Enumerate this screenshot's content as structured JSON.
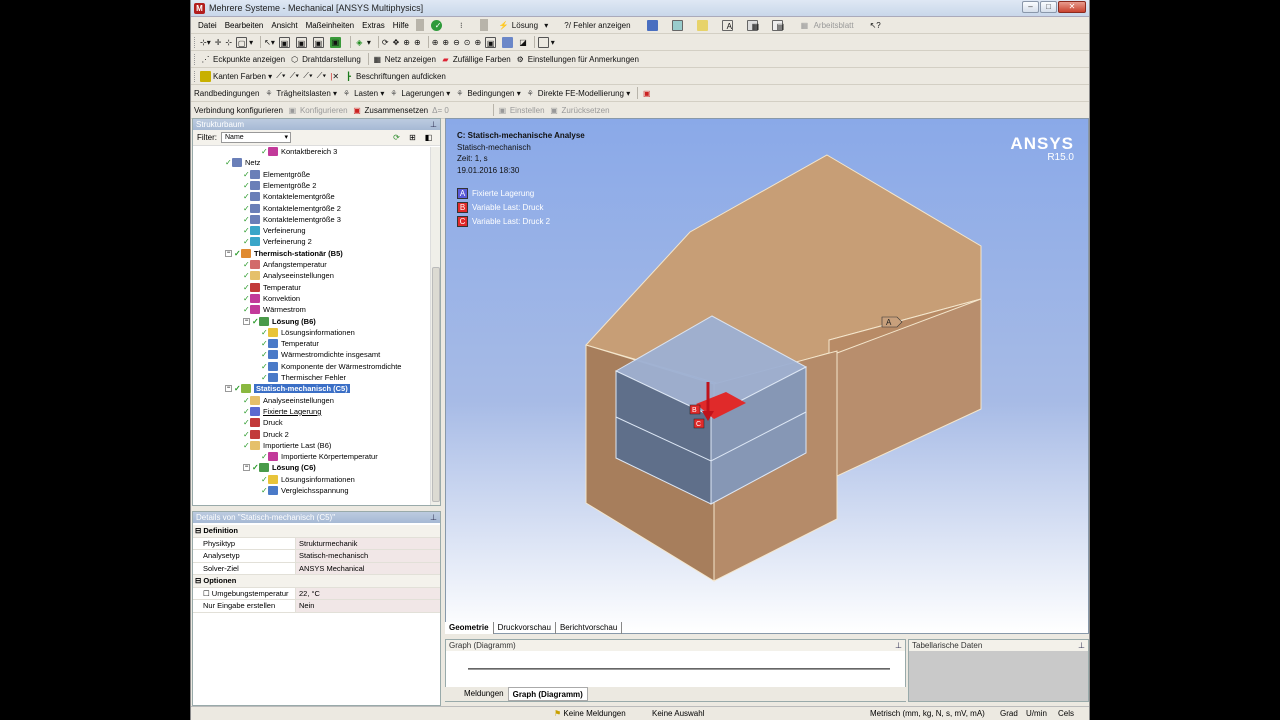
{
  "window": {
    "title": "Mehrere Systeme - Mechanical [ANSYS Multiphysics]"
  },
  "menu": [
    "Datei",
    "Bearbeiten",
    "Ansicht",
    "Maßeinheiten",
    "Extras",
    "Hilfe"
  ],
  "toolbar1": {
    "solve": "Lösung",
    "show_errors": "?/ Fehler anzeigen",
    "worksheet": "Arbeitsblatt"
  },
  "toolbar3": {
    "corners": "Eckpunkte anzeigen",
    "wireframe": "Drahtdarstellung",
    "mesh": "Netz anzeigen",
    "random_colors": "Zufällige Farben",
    "annotation_settings": "Einstellungen für Anmerkungen"
  },
  "toolbar4": {
    "edge_colors": "Kanten Farben",
    "labels": "Beschriftungen aufdicken"
  },
  "toolbar5": {
    "bc": "Randbedingungen",
    "inertial": "Trägheitslasten",
    "loads": "Lasten",
    "supports": "Lagerungen",
    "conditions": "Bedingungen",
    "direct_fe": "Direkte FE-Modellierung"
  },
  "toolbar6": {
    "connection": "Verbindung konfigurieren",
    "configure": "Konfigurieren",
    "assemble": "Zusammensetzen",
    "delta": "Δ=",
    "delta_value": "0",
    "set": "Einstellen",
    "reset": "Zurücksetzen"
  },
  "tree": {
    "title": "Strukturbaum",
    "filter_label": "Filter:",
    "filter_value": "Name",
    "nodes": [
      {
        "label": "Kontaktbereich 3",
        "level": 3,
        "icon": "#c23a9a"
      },
      {
        "label": "Netz",
        "level": 1,
        "icon": "#6a7fb8"
      },
      {
        "label": "Elementgröße",
        "level": 2,
        "icon": "#6a7fb8"
      },
      {
        "label": "Elementgröße 2",
        "level": 2,
        "icon": "#6a7fb8"
      },
      {
        "label": "Kontaktelementgröße",
        "level": 2,
        "icon": "#6a7fb8"
      },
      {
        "label": "Kontaktelementgröße 2",
        "level": 2,
        "icon": "#6a7fb8"
      },
      {
        "label": "Kontaktelementgröße 3",
        "level": 2,
        "icon": "#6a7fb8"
      },
      {
        "label": "Verfeinerung",
        "level": 2,
        "icon": "#3aa6c8"
      },
      {
        "label": "Verfeinerung 2",
        "level": 2,
        "icon": "#3aa6c8"
      },
      {
        "label": "Thermisch-stationär (B5)",
        "level": 1,
        "icon": "#e08a30",
        "bold": true
      },
      {
        "label": "Anfangstemperatur",
        "level": 2,
        "icon": "#d26b6b"
      },
      {
        "label": "Analyseeinstellungen",
        "level": 2,
        "icon": "#e5c06a"
      },
      {
        "label": "Temperatur",
        "level": 2,
        "icon": "#c23a3a"
      },
      {
        "label": "Konvektion",
        "level": 2,
        "icon": "#c23a9a"
      },
      {
        "label": "Wärmestrom",
        "level": 2,
        "icon": "#c23a9a"
      },
      {
        "label": "Lösung (B6)",
        "level": 2,
        "icon": "#4a9a4a",
        "bold": true
      },
      {
        "label": "Lösungsinformationen",
        "level": 3,
        "icon": "#e8c43a"
      },
      {
        "label": "Temperatur",
        "level": 3,
        "icon": "#4a7ac8"
      },
      {
        "label": "Wärmestromdichte insgesamt",
        "level": 3,
        "icon": "#4a7ac8"
      },
      {
        "label": "Komponente der Wärmestromdichte",
        "level": 3,
        "icon": "#4a7ac8"
      },
      {
        "label": "Thermischer Fehler",
        "level": 3,
        "icon": "#4a7ac8"
      },
      {
        "label": "Statisch-mechanisch (C5)",
        "level": 1,
        "icon": "#8ab840",
        "bold": true,
        "selected": true
      },
      {
        "label": "Analyseeinstellungen",
        "level": 2,
        "icon": "#e5c06a"
      },
      {
        "label": "Fixierte Lagerung",
        "level": 2,
        "icon": "#5a6ad0",
        "underline": true
      },
      {
        "label": "Druck",
        "level": 2,
        "icon": "#c23a3a"
      },
      {
        "label": "Druck 2",
        "level": 2,
        "icon": "#c23a3a"
      },
      {
        "label": "Importierte Last (B6)",
        "level": 2,
        "icon": "#e5c06a"
      },
      {
        "label": "Importierte Körpertemperatur",
        "level": 3,
        "icon": "#c23a9a"
      },
      {
        "label": "Lösung (C6)",
        "level": 2,
        "icon": "#4a9a4a",
        "bold": true
      },
      {
        "label": "Lösungsinformationen",
        "level": 3,
        "icon": "#e8c43a"
      },
      {
        "label": "Vergleichsspannung",
        "level": 3,
        "icon": "#4a7ac8"
      }
    ]
  },
  "details": {
    "title": "Details von \"Statisch-mechanisch (C5)\"",
    "rows": [
      {
        "k": "Definition",
        "group": true
      },
      {
        "k": "Physiktyp",
        "v": "Strukturmechanik"
      },
      {
        "k": "Analysetyp",
        "v": "Statisch-mechanisch"
      },
      {
        "k": "Solver-Ziel",
        "v": "ANSYS Mechanical"
      },
      {
        "k": "Optionen",
        "group": true
      },
      {
        "k": "Umgebungstemperatur",
        "v": "22, °C",
        "check": true
      },
      {
        "k": "Nur Eingabe erstellen",
        "v": "Nein"
      }
    ]
  },
  "viewport": {
    "heading": "C: Statisch-mechanische Analyse",
    "sub": "Statisch-mechanisch",
    "time": "Zeit: 1, s",
    "date": "19.01.2016 18:30",
    "legend": [
      {
        "letter": "A",
        "label": "Fixierte Lagerung",
        "color": "#5a5ad8"
      },
      {
        "letter": "B",
        "label": "Variable Last: Druck",
        "color": "#e02a2a"
      },
      {
        "letter": "C",
        "label": "Variable Last: Druck 2",
        "color": "#e02a2a"
      }
    ],
    "brand": "ANSYS",
    "version": "R15.0",
    "marker_a": "A",
    "marker_b": "B",
    "marker_c": "C"
  },
  "view_tabs": [
    "Geometrie",
    "Druckvorschau",
    "Berichtvorschau"
  ],
  "graph": {
    "title": "Graph (Diagramm)",
    "tabs": [
      "Meldungen",
      "Graph (Diagramm)"
    ]
  },
  "tabular": {
    "title": "Tabellarische Daten"
  },
  "status": {
    "messages": "Keine Meldungen",
    "selection": "Keine Auswahl",
    "units": "Metrisch (mm, kg, N, s, mV, mA)",
    "deg": "Grad",
    "rpm": "U/min",
    "cels": "Cels"
  }
}
